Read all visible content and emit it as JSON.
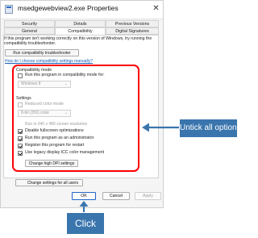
{
  "window": {
    "title": "msedgewebview2.exe Properties",
    "close_glyph": "✕"
  },
  "tabs_row1": [
    "Security",
    "Details",
    "Previous Versions"
  ],
  "tabs_row2": [
    "General",
    "Compatibility",
    "Digital Signatures"
  ],
  "active_tab": "Compatibility",
  "intro_text": "If this program isn't working correctly on this version of Windows, try running the compatibility troubleshooter.",
  "troubleshooter_button": "Run compatibility troubleshooter",
  "manual_link": "How do I choose compatibility settings manually?",
  "compat_mode": {
    "heading": "Compatibility mode",
    "checkbox_label": "Run this program in compatibility mode for:",
    "selected_os": "Windows 8",
    "caret": "⌄"
  },
  "settings": {
    "heading": "Settings",
    "reduced_color": "Reduced color mode",
    "color_select": "8-bit (256) color",
    "resolution": "Run in 640 x 480 screen resolution",
    "items": [
      {
        "label": "Disable fullscreen optimizations",
        "checked": true
      },
      {
        "label": "Run this program as an administrator",
        "checked": true
      },
      {
        "label": "Register this program for restart",
        "checked": true
      },
      {
        "label": "Use legacy display ICC color management",
        "checked": true
      }
    ],
    "dpi_button": "Change high DPI settings"
  },
  "all_users_button": "Change settings for all users",
  "footer": {
    "ok": "OK",
    "cancel": "Cancel",
    "apply": "Apply"
  },
  "annotations": {
    "untick": "Untick all options",
    "click": "Click"
  },
  "colors": {
    "callout_bg": "#3a75ad",
    "highlight": "#ff0000",
    "link": "#1a5fb4"
  }
}
